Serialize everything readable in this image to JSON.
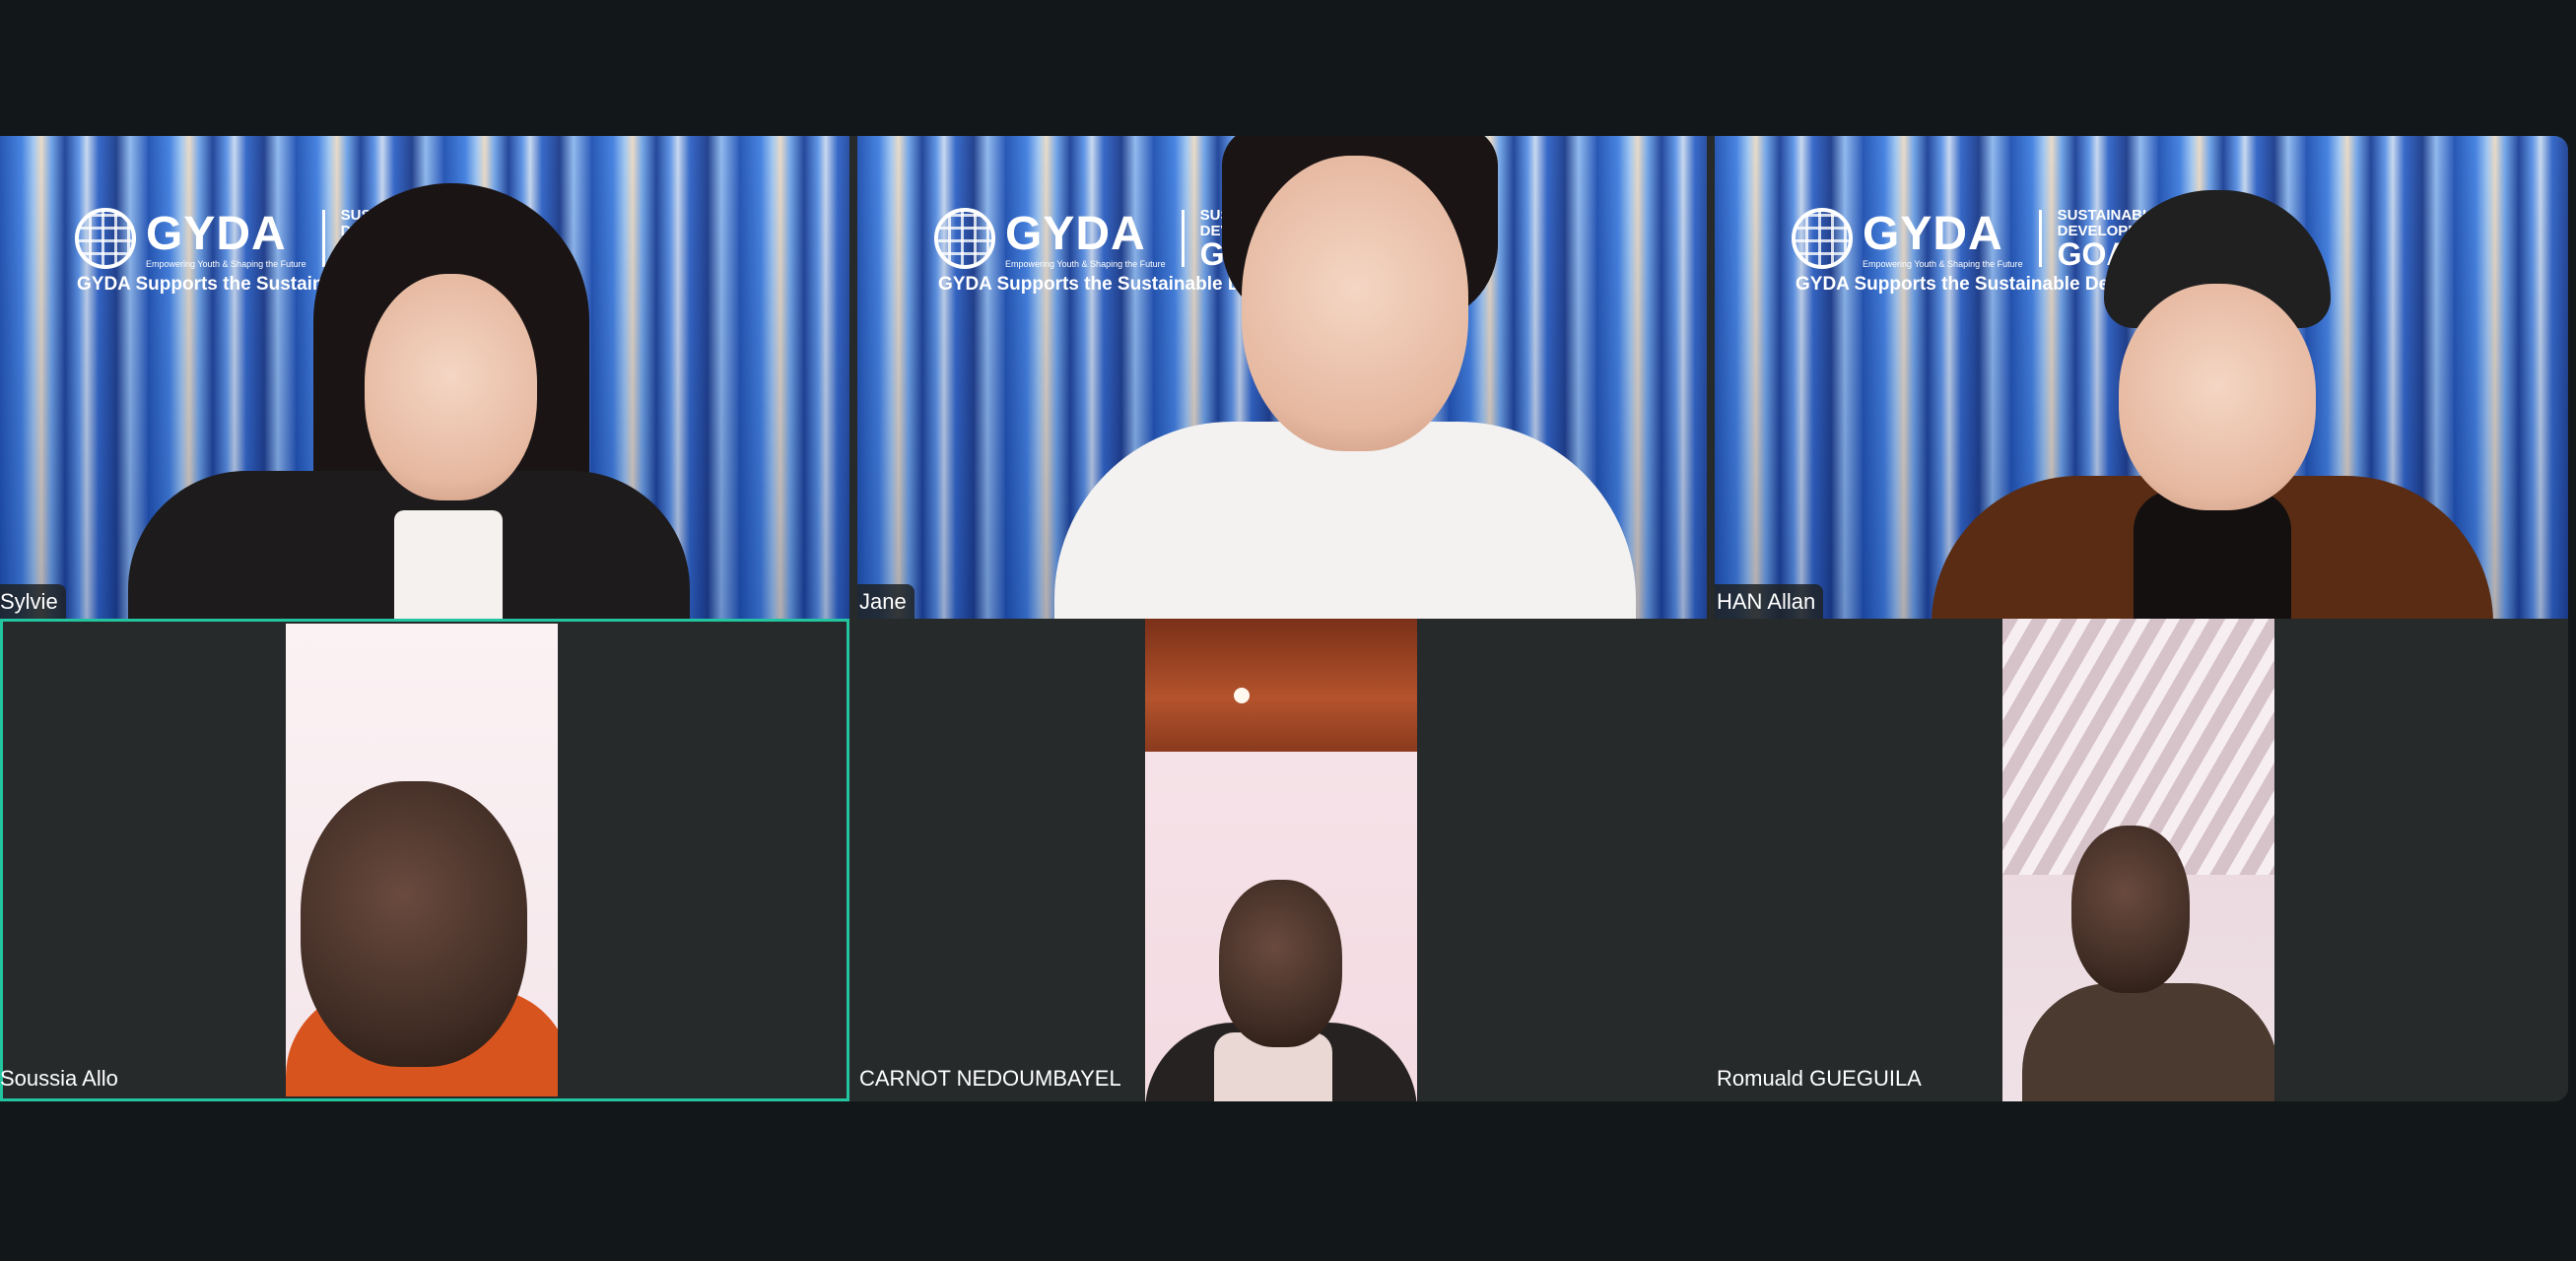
{
  "meeting": {
    "background": {
      "brand": "GYDA",
      "brand_sub": "Empowering Youth & Shaping the Future",
      "sdg_line1": "SUSTAINABLE",
      "sdg_line2": "DEVELOPMENT",
      "sdg_line3": "GOALS",
      "tagline": "GYDA Supports the Sustainable Development Goals"
    },
    "participants": [
      {
        "name": "Sylvie"
      },
      {
        "name": "Jane"
      },
      {
        "name": "HAN Allan"
      },
      {
        "name": "Soussia Allo",
        "active_speaker": true
      },
      {
        "name": "CARNOT NEDOUMBAYEL"
      },
      {
        "name": "Romuald GUEGUILA"
      }
    ]
  },
  "colors": {
    "window_bg": "#121819",
    "tile_bg": "#262a2b",
    "active_speaker_border": "#23c4a0",
    "nametag_bg": "#1e2223",
    "nametag_text": "#ffffff"
  }
}
